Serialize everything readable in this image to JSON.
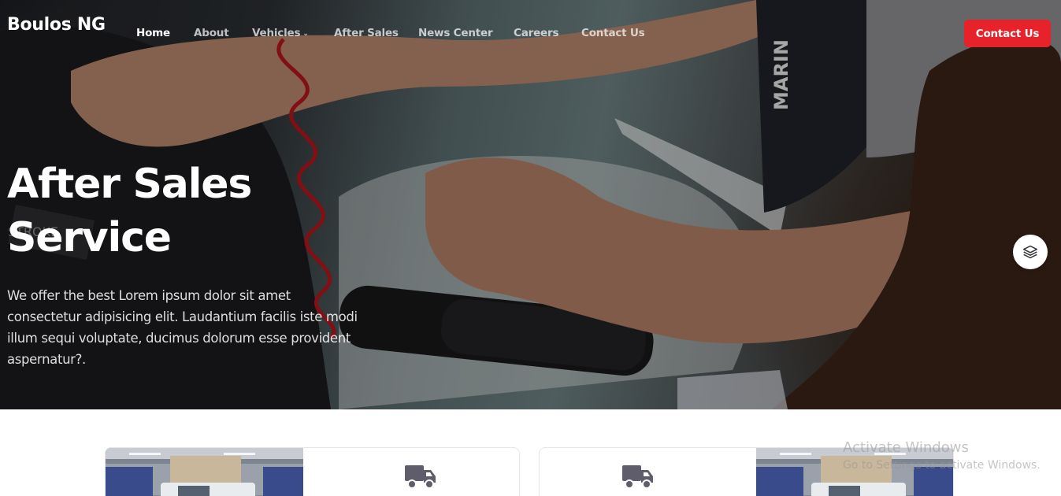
{
  "brand": {
    "name": "Boulos NG"
  },
  "nav": {
    "items": [
      {
        "label": "Home",
        "active": true
      },
      {
        "label": "About",
        "active": false
      },
      {
        "label": "Vehicles",
        "active": false,
        "has_dropdown": true
      },
      {
        "label": "After Sales",
        "active": false
      },
      {
        "label": "News Center",
        "active": false
      },
      {
        "label": "Careers",
        "active": false
      },
      {
        "label": "Contact Us",
        "active": false
      }
    ],
    "cta_label": "Contact Us",
    "dropdown_glyph": "⌄"
  },
  "hero": {
    "title_line1": "After Sales",
    "title_line2": "Service",
    "description": "We offer the best Lorem ipsum dolor sit amet consectetur adipisicing elit. Laudantium facilis iste modi illum sequi voluptate, ducimus dolorum esse provident aspernatur?."
  },
  "widgets": {
    "layers_icon": "layers-icon"
  },
  "cards": [
    {
      "icon": "truck-icon",
      "image": "workshop-truck-photo"
    },
    {
      "icon": "truck-icon",
      "image": "workshop-truck-photo"
    }
  ],
  "watermark": {
    "title": "Activate Windows",
    "subtitle": "Go to Settings to activate Windows."
  },
  "colors": {
    "accent": "#e8222a",
    "icon_gray": "#5f5d6b",
    "text_white": "#ffffff"
  }
}
